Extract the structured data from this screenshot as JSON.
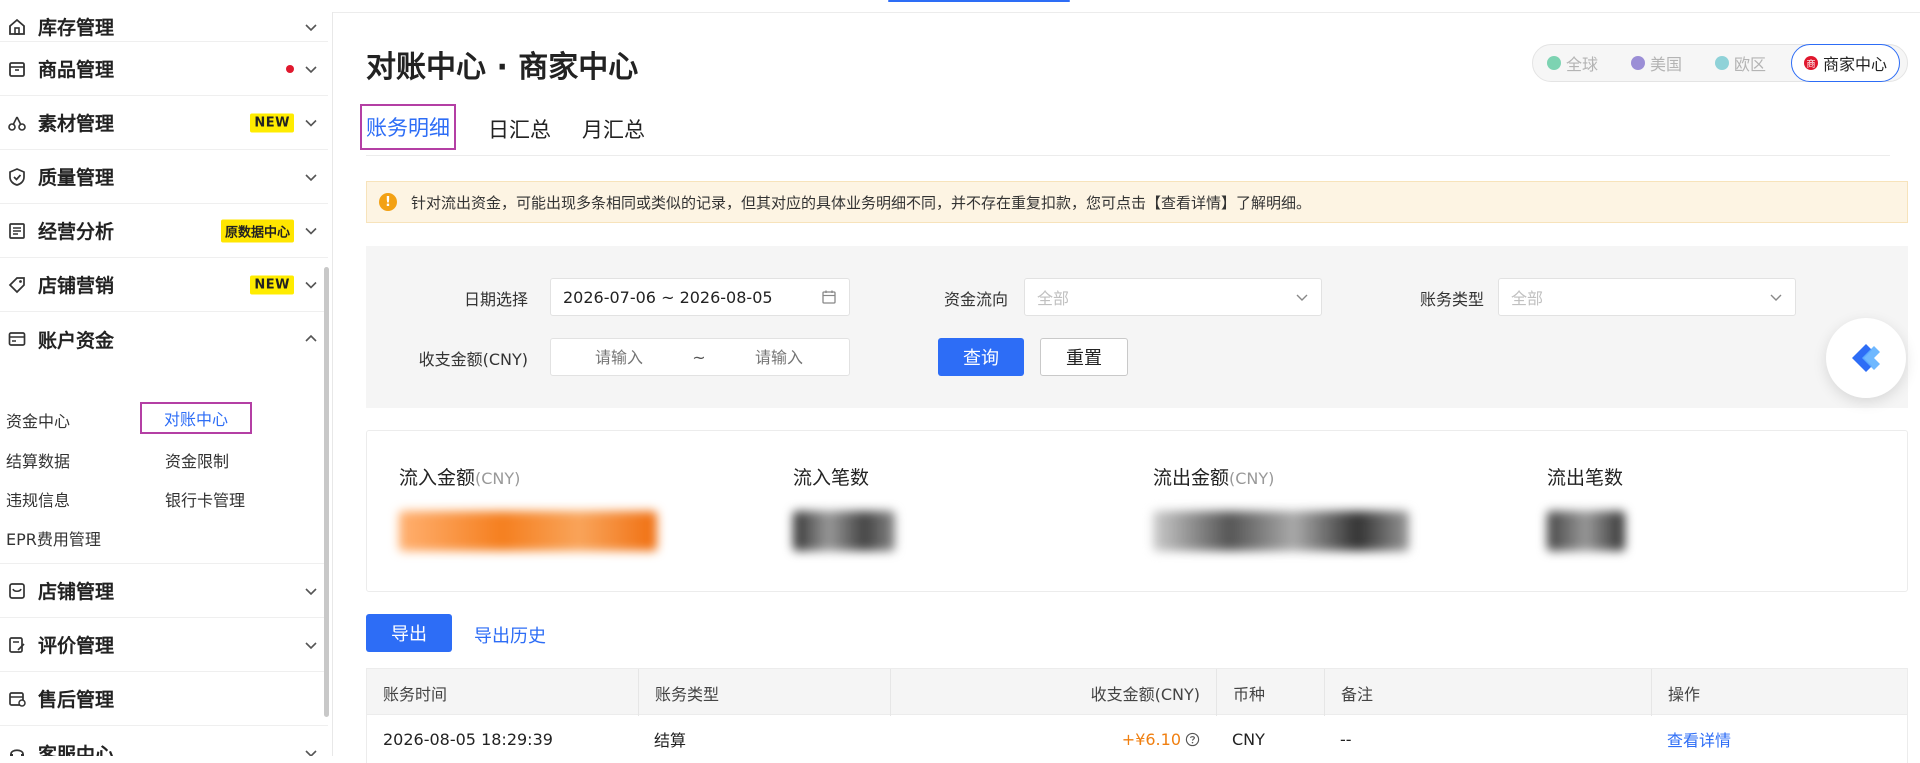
{
  "sidebar": {
    "items": [
      {
        "label": "库存管理",
        "icon": "home-icon"
      },
      {
        "label": "商品管理",
        "icon": "box-icon",
        "dot": true
      },
      {
        "label": "素材管理",
        "icon": "material-icon",
        "badge": "NEW"
      },
      {
        "label": "质量管理",
        "icon": "shield-check-icon"
      },
      {
        "label": "经营分析",
        "icon": "analytics-icon",
        "badge": "原数据中心"
      },
      {
        "label": "店铺营销",
        "icon": "tag-icon",
        "badge": "NEW"
      },
      {
        "label": "账户资金",
        "icon": "wallet-icon",
        "expanded": true
      },
      {
        "label": "店铺管理",
        "icon": "store-icon"
      },
      {
        "label": "评价管理",
        "icon": "review-icon"
      },
      {
        "label": "售后管理",
        "icon": "aftersale-icon"
      },
      {
        "label": "客服中心",
        "icon": "service-icon"
      }
    ],
    "sub_items": [
      "资金中心",
      "对账中心",
      "结算数据",
      "资金限制",
      "违规信息",
      "银行卡管理",
      "EPR费用管理"
    ]
  },
  "header": {
    "title": "对账中心 · 商家中心",
    "regions": [
      {
        "label": "全球",
        "color": "#7dd3b2"
      },
      {
        "label": "美国",
        "color": "#9b8ed6"
      },
      {
        "label": "欧区",
        "color": "#8fd2d8"
      },
      {
        "label": "商家中心",
        "color": "#e0182e",
        "icon_char": "商"
      }
    ]
  },
  "tabs": [
    "账务明细",
    "日汇总",
    "月汇总"
  ],
  "notice": "针对流出资金，可能出现多条相同或类似的记录，但其对应的具体业务明细不同，并不存在重复扣款，您可点击【查看详情】了解明细。",
  "filters": {
    "date_label": "日期选择",
    "date_value": "2026-07-06 ~ 2026-08-05",
    "flow_label": "资金流向",
    "flow_value": "全部",
    "type_label": "账务类型",
    "type_value": "全部",
    "amount_label": "收支金额(CNY)",
    "amount_min_placeholder": "请输入",
    "amount_sep": "~",
    "amount_max_placeholder": "请输入",
    "query_button": "查询",
    "reset_button": "重置"
  },
  "stats": [
    {
      "label": "流入金额",
      "unit": "(CNY)"
    },
    {
      "label": "流入笔数",
      "unit": ""
    },
    {
      "label": "流出金额",
      "unit": "(CNY)"
    },
    {
      "label": "流出笔数",
      "unit": ""
    }
  ],
  "actions": {
    "export": "导出",
    "history": "导出历史"
  },
  "table": {
    "columns": [
      "账务时间",
      "账务类型",
      "收支金额(CNY)",
      "币种",
      "备注",
      "操作"
    ],
    "rows": [
      {
        "time": "2026-08-05 18:29:39",
        "type": "结算",
        "amount": "+¥6.10",
        "currency": "CNY",
        "note": "--",
        "action": "查看详情"
      }
    ]
  },
  "colors": {
    "accent": "#2d6df6",
    "amount": "#f07f10",
    "highlight_border": "#b43fa4"
  }
}
